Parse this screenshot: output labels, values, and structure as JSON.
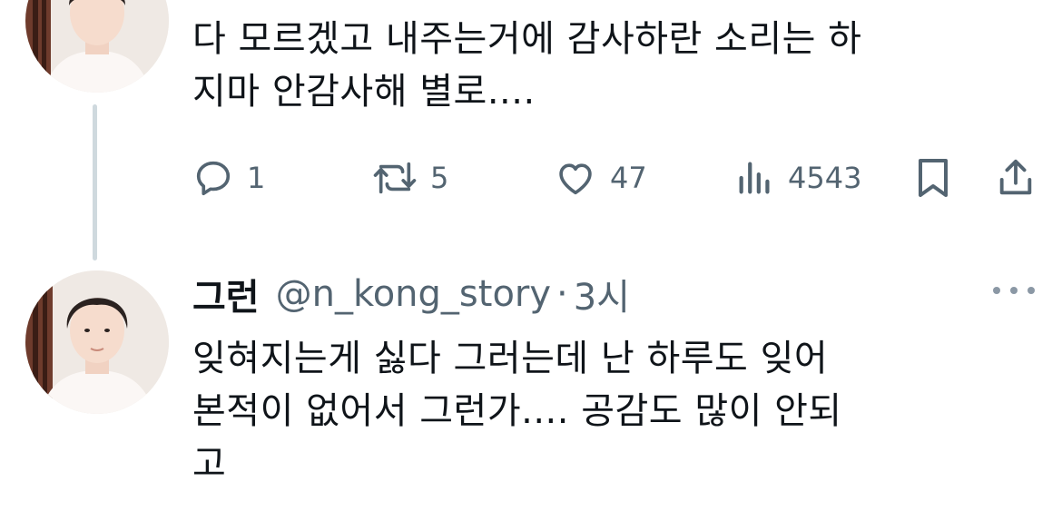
{
  "tweets": [
    {
      "text": "다 모르겠고 내주는거에 감사하란 소리는 하\n지마 안감사해 별로....",
      "actions": {
        "replies": "1",
        "retweets": "5",
        "likes": "47",
        "views": "4543"
      },
      "icons": [
        "reply-icon",
        "retweet-icon",
        "heart-icon",
        "views-icon",
        "bookmark-icon",
        "share-icon"
      ]
    },
    {
      "display_name": "그런",
      "handle": "@n_kong_story",
      "separator": "·",
      "time": "3시",
      "text": "잊혀지는게 싫다 그러는데 난 하루도 잊어\n본적이 없어서 그런가.... 공감도 많이 안되\n고",
      "more_icon": "more-horizontal-icon"
    }
  ],
  "colors": {
    "text": "#0f1419",
    "secondary": "#536471",
    "thread_line": "#cfd9de"
  }
}
